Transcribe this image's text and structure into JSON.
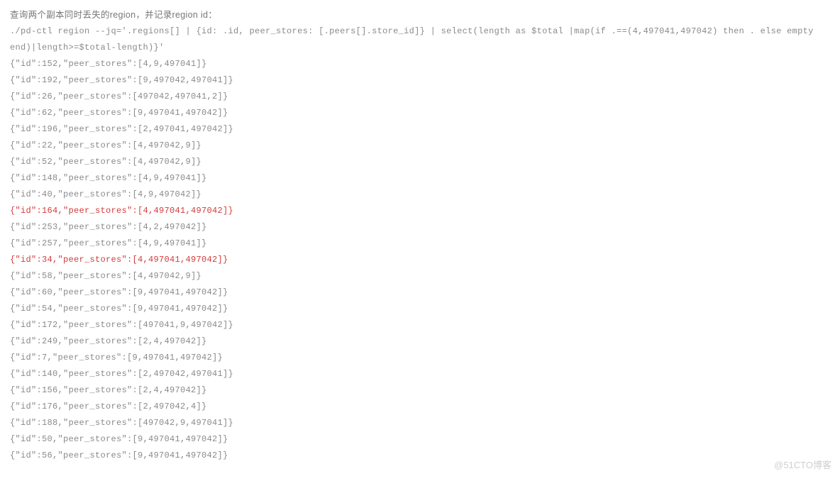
{
  "title": "查询两个副本同时丢失的region，并记录region id：",
  "command": "./pd-ctl region --jq='.regions[] | {id: .id, peer_stores: [.peers[].store_id]} | select(length as $total |map(if .==(4,497041,497042) then . else empty end)|length>=$total-length)}'",
  "rows": [
    {
      "id": 152,
      "peer_stores": [
        4,
        9,
        497041
      ],
      "hl": false
    },
    {
      "id": 192,
      "peer_stores": [
        9,
        497042,
        497041
      ],
      "hl": false
    },
    {
      "id": 26,
      "peer_stores": [
        497042,
        497041,
        2
      ],
      "hl": false
    },
    {
      "id": 62,
      "peer_stores": [
        9,
        497041,
        497042
      ],
      "hl": false
    },
    {
      "id": 196,
      "peer_stores": [
        2,
        497041,
        497042
      ],
      "hl": false
    },
    {
      "id": 22,
      "peer_stores": [
        4,
        497042,
        9
      ],
      "hl": false
    },
    {
      "id": 52,
      "peer_stores": [
        4,
        497042,
        9
      ],
      "hl": false
    },
    {
      "id": 148,
      "peer_stores": [
        4,
        9,
        497041
      ],
      "hl": false
    },
    {
      "id": 40,
      "peer_stores": [
        4,
        9,
        497042
      ],
      "hl": false
    },
    {
      "id": 164,
      "peer_stores": [
        4,
        497041,
        497042
      ],
      "hl": true
    },
    {
      "id": 253,
      "peer_stores": [
        4,
        2,
        497042
      ],
      "hl": false
    },
    {
      "id": 257,
      "peer_stores": [
        4,
        9,
        497041
      ],
      "hl": false
    },
    {
      "id": 34,
      "peer_stores": [
        4,
        497041,
        497042
      ],
      "hl": true
    },
    {
      "id": 58,
      "peer_stores": [
        4,
        497042,
        9
      ],
      "hl": false
    },
    {
      "id": 60,
      "peer_stores": [
        9,
        497041,
        497042
      ],
      "hl": false
    },
    {
      "id": 54,
      "peer_stores": [
        9,
        497041,
        497042
      ],
      "hl": false
    },
    {
      "id": 172,
      "peer_stores": [
        497041,
        9,
        497042
      ],
      "hl": false
    },
    {
      "id": 249,
      "peer_stores": [
        2,
        4,
        497042
      ],
      "hl": false
    },
    {
      "id": 7,
      "peer_stores": [
        9,
        497041,
        497042
      ],
      "hl": false
    },
    {
      "id": 140,
      "peer_stores": [
        2,
        497042,
        497041
      ],
      "hl": false
    },
    {
      "id": 156,
      "peer_stores": [
        2,
        4,
        497042
      ],
      "hl": false
    },
    {
      "id": 176,
      "peer_stores": [
        2,
        497042,
        4
      ],
      "hl": false
    },
    {
      "id": 188,
      "peer_stores": [
        497042,
        9,
        497041
      ],
      "hl": false
    },
    {
      "id": 50,
      "peer_stores": [
        9,
        497041,
        497042
      ],
      "hl": false
    },
    {
      "id": 56,
      "peer_stores": [
        9,
        497041,
        497042
      ],
      "hl": false
    }
  ],
  "watermark": "@51CTO博客"
}
